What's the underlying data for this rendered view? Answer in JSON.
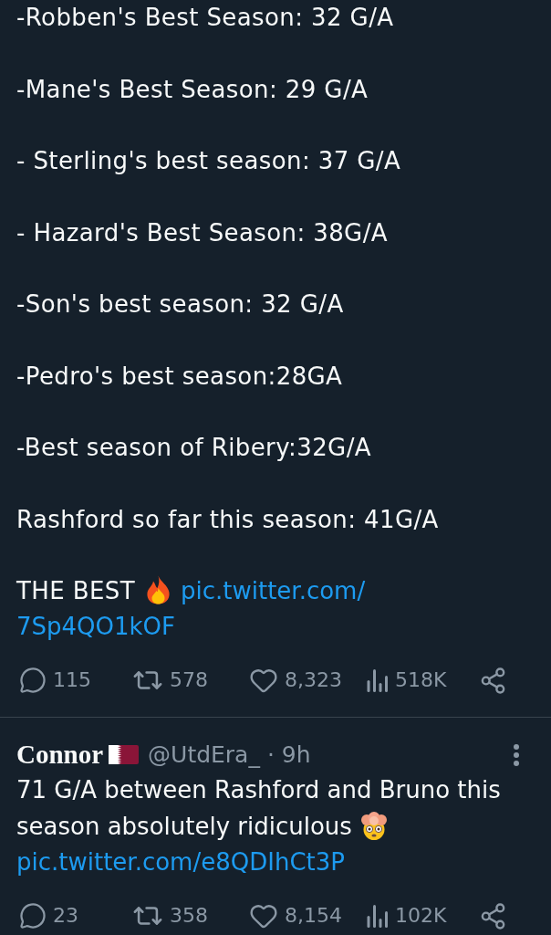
{
  "thread": {
    "paragraphs": [
      "-Robben's Best Season: 32 G/A",
      "-Mane's Best Season: 29 G/A",
      "- Sterling's best season: 37 G/A",
      "- Hazard's Best Season: 38G/A",
      "-Son's best season: 32 G/A",
      "-Pedro's best season:28GA",
      "-Best season of Ribery:32G/A",
      "Rashford so far this season: 41G/A"
    ],
    "closing": {
      "text": "THE BEST",
      "link_lines": [
        "pic.twitter.com/",
        "7Sp4QO1kOF"
      ]
    },
    "actions": [
      {
        "kind": "reply",
        "count": "115"
      },
      {
        "kind": "retweet",
        "count": "578"
      },
      {
        "kind": "like",
        "count": "8,323"
      },
      {
        "kind": "views",
        "count": "518K"
      },
      {
        "kind": "share"
      }
    ]
  },
  "reply": {
    "author": {
      "name": "Connor",
      "handle_and_time": "@UtdEra_ · 9h"
    },
    "text": "71 G/A between Rashford and Bruno this season absolutely ridiculous",
    "link": "pic.twitter.com/e8QDIhCt3P",
    "actions": [
      {
        "kind": "reply",
        "count": "23"
      },
      {
        "kind": "retweet",
        "count": "358"
      },
      {
        "kind": "like",
        "count": "8,154"
      },
      {
        "kind": "views",
        "count": "102K"
      },
      {
        "kind": "share"
      }
    ]
  }
}
